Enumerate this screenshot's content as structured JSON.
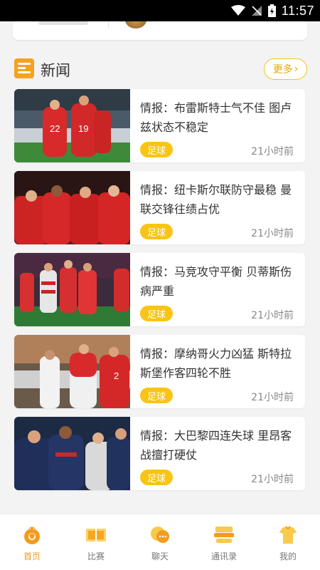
{
  "status_bar": {
    "time": "11:57"
  },
  "section": {
    "title": "新闻",
    "more_label": "更多"
  },
  "news": [
    {
      "title": "情报：布雷斯特士气不佳 图卢兹状态不稳定",
      "tag": "足球",
      "time": "21小时前"
    },
    {
      "title": "情报：纽卡斯尔联防守最稳 曼联交锋往绩占优",
      "tag": "足球",
      "time": "21小时前"
    },
    {
      "title": "情报：马竞攻守平衡 贝蒂斯伤病严重",
      "tag": "足球",
      "time": "21小时前"
    },
    {
      "title": "情报：摩纳哥火力凶猛 斯特拉斯堡作客四轮不胜",
      "tag": "足球",
      "time": "21小时前"
    },
    {
      "title": "情报：大巴黎四连失球 里昂客战擅打硬仗",
      "tag": "足球",
      "time": "21小时前"
    }
  ],
  "nav": [
    {
      "label": "首页",
      "icon": "home-icon",
      "active": true
    },
    {
      "label": "比赛",
      "icon": "match-icon",
      "active": false
    },
    {
      "label": "聊天",
      "icon": "chat-icon",
      "active": false
    },
    {
      "label": "通讯录",
      "icon": "contacts-icon",
      "active": false
    },
    {
      "label": "我的",
      "icon": "profile-icon",
      "active": false
    }
  ],
  "colors": {
    "accent": "#f29c1f",
    "tag": "#f9c413",
    "more_border": "#f5c518"
  }
}
